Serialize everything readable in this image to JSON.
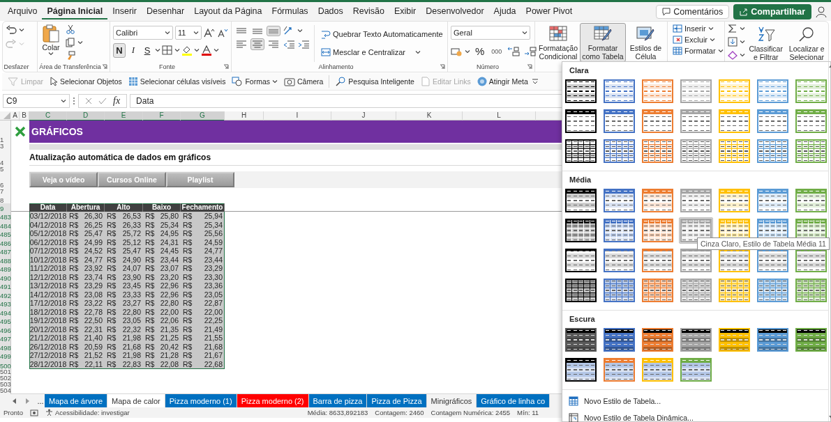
{
  "menu_tabs": [
    {
      "label": "Arquivo",
      "selected": false
    },
    {
      "label": "Página Inicial",
      "selected": true
    },
    {
      "label": "Inserir",
      "selected": false
    },
    {
      "label": "Desenhar",
      "selected": false
    },
    {
      "label": "Layout da Página",
      "selected": false
    },
    {
      "label": "Fórmulas",
      "selected": false
    },
    {
      "label": "Dados",
      "selected": false
    },
    {
      "label": "Revisão",
      "selected": false
    },
    {
      "label": "Exibir",
      "selected": false
    },
    {
      "label": "Desenvolvedor",
      "selected": false
    },
    {
      "label": "Ajuda",
      "selected": false
    },
    {
      "label": "Power Pivot",
      "selected": false
    }
  ],
  "header_buttons": {
    "comments": "Comentários",
    "share": "Compartilhar"
  },
  "ribbon": {
    "undo": {
      "label": "Desfazer"
    },
    "clipboard": {
      "label": "Área de Transferência",
      "paste": "Colar"
    },
    "font": {
      "label": "Fonte",
      "font_name": "Calibri",
      "font_size": "11",
      "styles": [
        {
          "label": "N",
          "pressed": true
        },
        {
          "label": "I",
          "pressed": false
        },
        {
          "label": "S",
          "pressed": false
        }
      ]
    },
    "alignment": {
      "label": "Alinhamento",
      "vertical": [
        {
          "pressed": false
        },
        {
          "pressed": false
        },
        {
          "pressed": true
        }
      ],
      "horizontal": [
        {
          "pressed": false
        },
        {
          "pressed": true
        },
        {
          "pressed": false
        }
      ],
      "wrap": "Quebrar Texto Automaticamente",
      "merge": "Mesclar e Centralizar"
    },
    "number": {
      "label": "Número",
      "format": "Geral",
      "percent": "%",
      "thousands": "000"
    },
    "styles": [
      {
        "label": "Formatação Condicional",
        "pressed": false,
        "kind": "conditional"
      },
      {
        "label": "Formatar como Tabela",
        "pressed": true,
        "kind": "table"
      },
      {
        "label": "Estilos de Célula",
        "pressed": false,
        "kind": "cell"
      }
    ],
    "cells": [
      {
        "label": "Inserir",
        "kind": "insert"
      },
      {
        "label": "Excluir",
        "kind": "delete"
      },
      {
        "label": "Formatar",
        "kind": "format"
      }
    ],
    "editing": [
      {
        "label": "Classificar e Filtrar",
        "kind": "sort"
      },
      {
        "label": "Localizar e Selecionar",
        "kind": "find"
      }
    ]
  },
  "quick_toolbar": [
    {
      "label": "Limpar",
      "disabled": true,
      "kind": "clear"
    },
    {
      "label": "Selecionar Objetos",
      "disabled": false,
      "kind": "pointer"
    },
    {
      "label": "Selecionar células visíveis",
      "disabled": false,
      "kind": "cells"
    },
    {
      "label": "Formas",
      "disabled": false,
      "kind": "shapes"
    },
    {
      "label": "Câmera",
      "disabled": false,
      "kind": "camera"
    },
    {
      "label": "Pesquisa Inteligente",
      "disabled": false,
      "kind": "search"
    },
    {
      "label": "Editar Links",
      "disabled": true,
      "kind": "links"
    },
    {
      "label": "Atingir Meta",
      "disabled": false,
      "kind": "goal"
    }
  ],
  "formula_bar": {
    "name_box": "C9",
    "function_label": "fx",
    "formula": "Data"
  },
  "sheet": {
    "columns": [
      {
        "label": "A",
        "selected": false
      },
      {
        "label": "B",
        "selected": false
      },
      {
        "label": "C",
        "selected": true
      },
      {
        "label": "D",
        "selected": true
      },
      {
        "label": "E",
        "selected": true
      },
      {
        "label": "F",
        "selected": true
      },
      {
        "label": "G",
        "selected": true
      },
      {
        "label": "H",
        "selected": false
      },
      {
        "label": "I",
        "selected": false
      },
      {
        "label": "J",
        "selected": false
      },
      {
        "label": "K",
        "selected": false
      },
      {
        "label": "L",
        "selected": false
      }
    ],
    "rows": [
      {
        "label": "1",
        "kind": "banner",
        "selected": false,
        "text": "GRÁFICOS"
      },
      {
        "label": "3",
        "kind": "band",
        "selected": false
      },
      {
        "label": "4",
        "kind": "title",
        "selected": false,
        "text": "Atualização automática de dados em gráficos"
      },
      {
        "label": "5",
        "kind": "spacer",
        "selected": false
      },
      {
        "label": "6",
        "kind": "buttons",
        "selected": false,
        "buttons": [
          "Veja o vídeo",
          "Cursos Online",
          "Playlist"
        ]
      },
      {
        "label": "7",
        "kind": "spacer",
        "selected": false
      },
      {
        "label": "8",
        "kind": "blank",
        "selected": false
      },
      {
        "label": "9",
        "kind": "header",
        "selected": true,
        "cells": [
          "Data",
          "Abertura",
          "Alto",
          "Baixo",
          "Fechamento"
        ]
      },
      {
        "label": "483",
        "kind": "data",
        "selected": true,
        "cells": [
          "03/12/2018",
          "R$",
          "26,30",
          "R$",
          "26,53",
          "R$",
          "25,80",
          "R$",
          "25,94"
        ]
      },
      {
        "label": "484",
        "kind": "data",
        "selected": true,
        "cells": [
          "04/12/2018",
          "R$",
          "26,25",
          "R$",
          "26,33",
          "R$",
          "25,34",
          "R$",
          "25,34"
        ]
      },
      {
        "label": "485",
        "kind": "data",
        "selected": true,
        "cells": [
          "05/12/2018",
          "R$",
          "25,47",
          "R$",
          "25,72",
          "R$",
          "24,95",
          "R$",
          "25,56"
        ]
      },
      {
        "label": "486",
        "kind": "data",
        "selected": true,
        "cells": [
          "06/12/2018",
          "R$",
          "24,99",
          "R$",
          "25,12",
          "R$",
          "24,31",
          "R$",
          "24,59"
        ]
      },
      {
        "label": "487",
        "kind": "data",
        "selected": true,
        "cells": [
          "07/12/2018",
          "R$",
          "24,52",
          "R$",
          "25,47",
          "R$",
          "24,45",
          "R$",
          "24,77"
        ]
      },
      {
        "label": "488",
        "kind": "data",
        "selected": true,
        "cells": [
          "10/12/2018",
          "R$",
          "24,77",
          "R$",
          "24,90",
          "R$",
          "23,44",
          "R$",
          "23,44"
        ]
      },
      {
        "label": "489",
        "kind": "data",
        "selected": true,
        "cells": [
          "11/12/2018",
          "R$",
          "23,92",
          "R$",
          "24,07",
          "R$",
          "23,07",
          "R$",
          "23,29"
        ]
      },
      {
        "label": "490",
        "kind": "data",
        "selected": true,
        "cells": [
          "12/12/2018",
          "R$",
          "23,74",
          "R$",
          "23,90",
          "R$",
          "23,20",
          "R$",
          "23,30"
        ]
      },
      {
        "label": "491",
        "kind": "data",
        "selected": true,
        "cells": [
          "13/12/2018",
          "R$",
          "23,29",
          "R$",
          "23,45",
          "R$",
          "22,96",
          "R$",
          "23,36"
        ]
      },
      {
        "label": "492",
        "kind": "data",
        "selected": true,
        "cells": [
          "14/12/2018",
          "R$",
          "23,08",
          "R$",
          "23,33",
          "R$",
          "22,96",
          "R$",
          "23,05"
        ]
      },
      {
        "label": "493",
        "kind": "data",
        "selected": true,
        "cells": [
          "17/12/2018",
          "R$",
          "23,22",
          "R$",
          "23,27",
          "R$",
          "22,80",
          "R$",
          "22,87"
        ]
      },
      {
        "label": "494",
        "kind": "data",
        "selected": true,
        "cells": [
          "18/12/2018",
          "R$",
          "22,78",
          "R$",
          "22,80",
          "R$",
          "22,00",
          "R$",
          "22,00"
        ]
      },
      {
        "label": "495",
        "kind": "data",
        "selected": true,
        "cells": [
          "19/12/2018",
          "R$",
          "22,50",
          "R$",
          "23,05",
          "R$",
          "22,06",
          "R$",
          "22,25"
        ]
      },
      {
        "label": "496",
        "kind": "data",
        "selected": true,
        "cells": [
          "20/12/2018",
          "R$",
          "22,31",
          "R$",
          "22,32",
          "R$",
          "21,35",
          "R$",
          "21,49"
        ]
      },
      {
        "label": "497",
        "kind": "data",
        "selected": true,
        "cells": [
          "21/12/2018",
          "R$",
          "21,40",
          "R$",
          "21,98",
          "R$",
          "21,25",
          "R$",
          "21,55"
        ]
      },
      {
        "label": "498",
        "kind": "data",
        "selected": true,
        "cells": [
          "26/12/2018",
          "R$",
          "20,59",
          "R$",
          "21,68",
          "R$",
          "20,42",
          "R$",
          "21,68"
        ]
      },
      {
        "label": "499",
        "kind": "data",
        "selected": true,
        "cells": [
          "27/12/2018",
          "R$",
          "21,52",
          "R$",
          "21,98",
          "R$",
          "21,28",
          "R$",
          "21,67"
        ]
      },
      {
        "label": "500",
        "kind": "data",
        "selected": true,
        "cells": [
          "28/12/2018",
          "R$",
          "22,11",
          "R$",
          "22,83",
          "R$",
          "22,08",
          "R$",
          "22,68"
        ]
      },
      {
        "label": "501",
        "kind": "blank",
        "selected": false
      },
      {
        "label": "502",
        "kind": "blank",
        "selected": false
      },
      {
        "label": "503",
        "kind": "blank",
        "selected": false
      },
      {
        "label": "504",
        "kind": "blank",
        "selected": false
      }
    ]
  },
  "sheet_tabs": {
    "more": "...",
    "tabs": [
      {
        "label": "Mapa de árvore",
        "selected": false,
        "color": "#0070c0"
      },
      {
        "label": "Mapa de calor",
        "selected": true
      },
      {
        "label": "Pizza moderno (1)",
        "selected": false,
        "color": "#0070c0"
      },
      {
        "label": "Pizza moderno (2)",
        "selected": false,
        "color": "#ff0000"
      },
      {
        "label": "Barra de pizza",
        "selected": false,
        "color": "#0070c0"
      },
      {
        "label": "Pizza de Pizza",
        "selected": false,
        "color": "#0070c0"
      },
      {
        "label": "Minigráficos",
        "selected": false
      },
      {
        "label": "Gráfico de linha co",
        "selected": false,
        "color": "#0070c0"
      }
    ]
  },
  "status_bar": {
    "ready": "Pronto",
    "accessibility": "Acessibilidade: investigar",
    "stats": [
      "Média: 8633,892183",
      "Contagem: 2460",
      "Contagem Numérica: 2455",
      "Mín: 11"
    ]
  },
  "table_styles_menu": {
    "sections": [
      {
        "title": "Clara",
        "rows": [
          {
            "kind": "light-lines",
            "styles": [
              {
                "color": "#000000",
                "selected": false
              },
              {
                "color": "#4472c4",
                "selected": false
              },
              {
                "color": "#ed7d31",
                "selected": false
              },
              {
                "color": "#a5a5a5",
                "selected": false
              },
              {
                "color": "#ffc000",
                "selected": false
              },
              {
                "color": "#5b9bd5",
                "selected": false
              },
              {
                "color": "#70ad47",
                "selected": false
              }
            ]
          },
          {
            "kind": "light-header",
            "styles": [
              {
                "color": "#000000",
                "selected": false
              },
              {
                "color": "#4472c4",
                "selected": false
              },
              {
                "color": "#ed7d31",
                "selected": false
              },
              {
                "color": "#a5a5a5",
                "selected": false
              },
              {
                "color": "#ffc000",
                "selected": false
              },
              {
                "color": "#5b9bd5",
                "selected": false
              },
              {
                "color": "#70ad47",
                "selected": false
              }
            ]
          },
          {
            "kind": "light-grid",
            "styles": [
              {
                "color": "#000000",
                "selected": false
              },
              {
                "color": "#4472c4",
                "selected": false
              },
              {
                "color": "#ed7d31",
                "selected": false
              },
              {
                "color": "#a5a5a5",
                "selected": false
              },
              {
                "color": "#ffc000",
                "selected": false
              },
              {
                "color": "#5b9bd5",
                "selected": false
              },
              {
                "color": "#70ad47",
                "selected": false
              }
            ]
          }
        ]
      },
      {
        "title": "Média",
        "rows": [
          {
            "kind": "medium-header",
            "styles": [
              {
                "color": "#000000",
                "selected": false
              },
              {
                "color": "#4472c4",
                "selected": false
              },
              {
                "color": "#ed7d31",
                "selected": false
              },
              {
                "color": "#a5a5a5",
                "selected": false
              },
              {
                "color": "#ffc000",
                "selected": false
              },
              {
                "color": "#5b9bd5",
                "selected": false
              },
              {
                "color": "#70ad47",
                "selected": false
              }
            ]
          },
          {
            "kind": "medium-banded",
            "styles": [
              {
                "color": "#000000",
                "selected": false
              },
              {
                "color": "#4472c4",
                "selected": false
              },
              {
                "color": "#ed7d31",
                "selected": false
              },
              {
                "color": "#a5a5a5",
                "selected": true
              },
              {
                "color": "#ffc000",
                "selected": false
              },
              {
                "color": "#5b9bd5",
                "selected": false
              },
              {
                "color": "#70ad47",
                "selected": false
              }
            ]
          },
          {
            "kind": "medium-rule",
            "styles": [
              {
                "color": "#000000",
                "selected": false
              },
              {
                "color": "#4472c4",
                "selected": false
              },
              {
                "color": "#ed7d31",
                "selected": false
              },
              {
                "color": "#a5a5a5",
                "selected": false
              },
              {
                "color": "#ffc000",
                "selected": false
              },
              {
                "color": "#5b9bd5",
                "selected": false
              },
              {
                "color": "#70ad47",
                "selected": false
              }
            ]
          },
          {
            "kind": "medium-grid",
            "styles": [
              {
                "color": "#000000",
                "selected": false
              },
              {
                "color": "#4472c4",
                "selected": false
              },
              {
                "color": "#ed7d31",
                "selected": false
              },
              {
                "color": "#a5a5a5",
                "selected": false
              },
              {
                "color": "#ffc000",
                "selected": false
              },
              {
                "color": "#5b9bd5",
                "selected": false
              },
              {
                "color": "#70ad47",
                "selected": false
              }
            ]
          }
        ]
      },
      {
        "title": "Escura",
        "rows": [
          {
            "kind": "dark",
            "styles": [
              {
                "color": "#595959",
                "selected": false
              },
              {
                "color": "#4472c4",
                "selected": false
              },
              {
                "color": "#ed7d31",
                "selected": false
              },
              {
                "color": "#a5a5a5",
                "selected": false
              },
              {
                "color": "#ffc000",
                "selected": false
              },
              {
                "color": "#5b9bd5",
                "selected": false
              },
              {
                "color": "#70ad47",
                "selected": false
              }
            ]
          },
          {
            "kind": "dark-light",
            "styles": [
              {
                "color": "#000000",
                "selected": false
              },
              {
                "color": "#ed7d31",
                "selected": false
              },
              {
                "color": "#ffc000",
                "selected": false
              },
              {
                "color": "#70ad47",
                "selected": false
              }
            ]
          }
        ]
      }
    ],
    "tooltip": "Cinza Claro, Estilo de Tabela Média 11",
    "actions": [
      {
        "label": "Novo Estilo de Tabela...",
        "kind": "table"
      },
      {
        "label": "Novo Estilo de Tabela Dinâmica...",
        "kind": "pivot"
      }
    ]
  }
}
